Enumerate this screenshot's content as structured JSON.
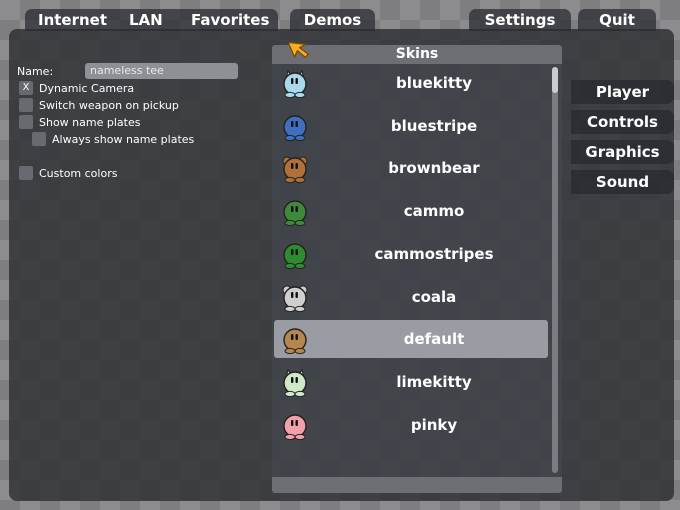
{
  "top_tabs": [
    {
      "label": "Internet"
    },
    {
      "label": "LAN"
    },
    {
      "label": "Favorites"
    },
    {
      "label": "Demos"
    },
    {
      "label": "Settings"
    },
    {
      "label": "Quit"
    }
  ],
  "settings_menu": [
    "Player",
    "Controls",
    "Graphics",
    "Sound"
  ],
  "player": {
    "name_label": "Name:",
    "name_value": "nameless tee",
    "options": [
      {
        "label": "Dynamic Camera",
        "checked": true,
        "mark": "X"
      },
      {
        "label": "Switch weapon on pickup",
        "checked": false,
        "mark": ""
      },
      {
        "label": "Show name plates",
        "checked": false,
        "mark": ""
      },
      {
        "label": "Always show name plates",
        "checked": false,
        "mark": ""
      },
      {
        "label": "Custom colors",
        "checked": false,
        "mark": ""
      }
    ]
  },
  "skins": {
    "title": "Skins",
    "selected": "default",
    "items": [
      {
        "name": "bluekitty",
        "body": "#a9d9ec",
        "ears": "kitty"
      },
      {
        "name": "bluestripe",
        "body": "#3f6fbf",
        "ears": "none"
      },
      {
        "name": "brownbear",
        "body": "#b0703a",
        "ears": "bear"
      },
      {
        "name": "cammo",
        "body": "#3f8a3a",
        "ears": "none"
      },
      {
        "name": "cammostripes",
        "body": "#2f8a30",
        "ears": "none"
      },
      {
        "name": "coala",
        "body": "#cfcfcf",
        "ears": "bear"
      },
      {
        "name": "default",
        "body": "#b5864d",
        "ears": "none"
      },
      {
        "name": "limekitty",
        "body": "#cfe8c8",
        "ears": "kitty"
      },
      {
        "name": "pinky",
        "body": "#f2a0ab",
        "ears": "none"
      }
    ]
  },
  "colors": {
    "panel": "#2f3137",
    "selected_row": "#9a9ca3",
    "cursor": "#f0b020"
  }
}
